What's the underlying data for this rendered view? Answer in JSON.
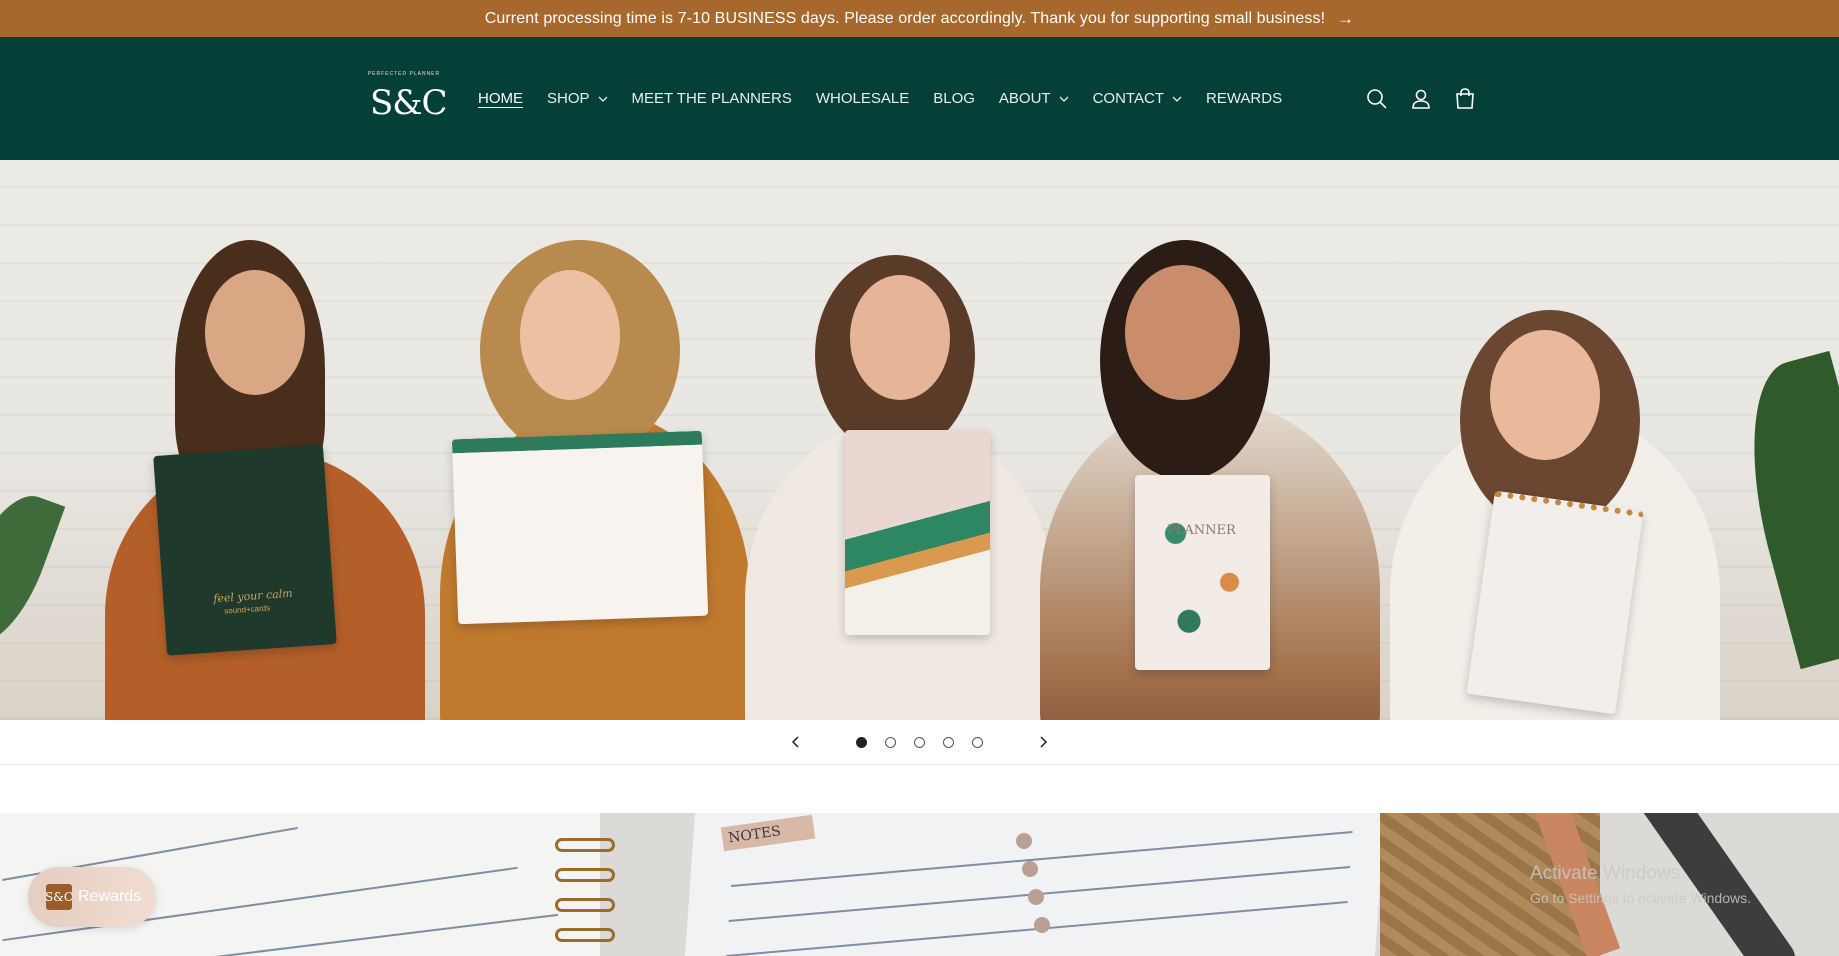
{
  "announcement": {
    "text": "Current processing time is 7-10 BUSINESS days. Please order accordingly. Thank you for supporting small business!",
    "arrow": "→"
  },
  "header": {
    "logo": {
      "mark": "S&C",
      "arc_text": "PERFECTED PLANNER"
    },
    "nav": [
      {
        "label": "HOME",
        "active": true,
        "has_dropdown": false
      },
      {
        "label": "SHOP",
        "active": false,
        "has_dropdown": true
      },
      {
        "label": "MEET THE PLANNERS",
        "active": false,
        "has_dropdown": false
      },
      {
        "label": "WHOLESALE",
        "active": false,
        "has_dropdown": false
      },
      {
        "label": "BLOG",
        "active": false,
        "has_dropdown": false
      },
      {
        "label": "ABOUT",
        "active": false,
        "has_dropdown": true
      },
      {
        "label": "CONTACT",
        "active": false,
        "has_dropdown": true
      },
      {
        "label": "REWARDS",
        "active": false,
        "has_dropdown": false
      }
    ],
    "icons": [
      "search-icon",
      "account-icon",
      "cart-icon"
    ]
  },
  "hero": {
    "book_text": "feel your calm",
    "book_subtext": "sound+cards",
    "planner_text": "PLANNER",
    "slides_total": 5,
    "active_slide": 1
  },
  "notes_section": {
    "tag": "NOTES"
  },
  "rewards_launcher": {
    "label": "Rewards",
    "logo": "S&C"
  },
  "watermark": {
    "line1": "Activate Windows",
    "line2": "Go to Settings to activate Windows."
  },
  "colors": {
    "announcement_bg": "#a6682d",
    "header_bg": "#043f38",
    "accent": "#9b5d28"
  }
}
